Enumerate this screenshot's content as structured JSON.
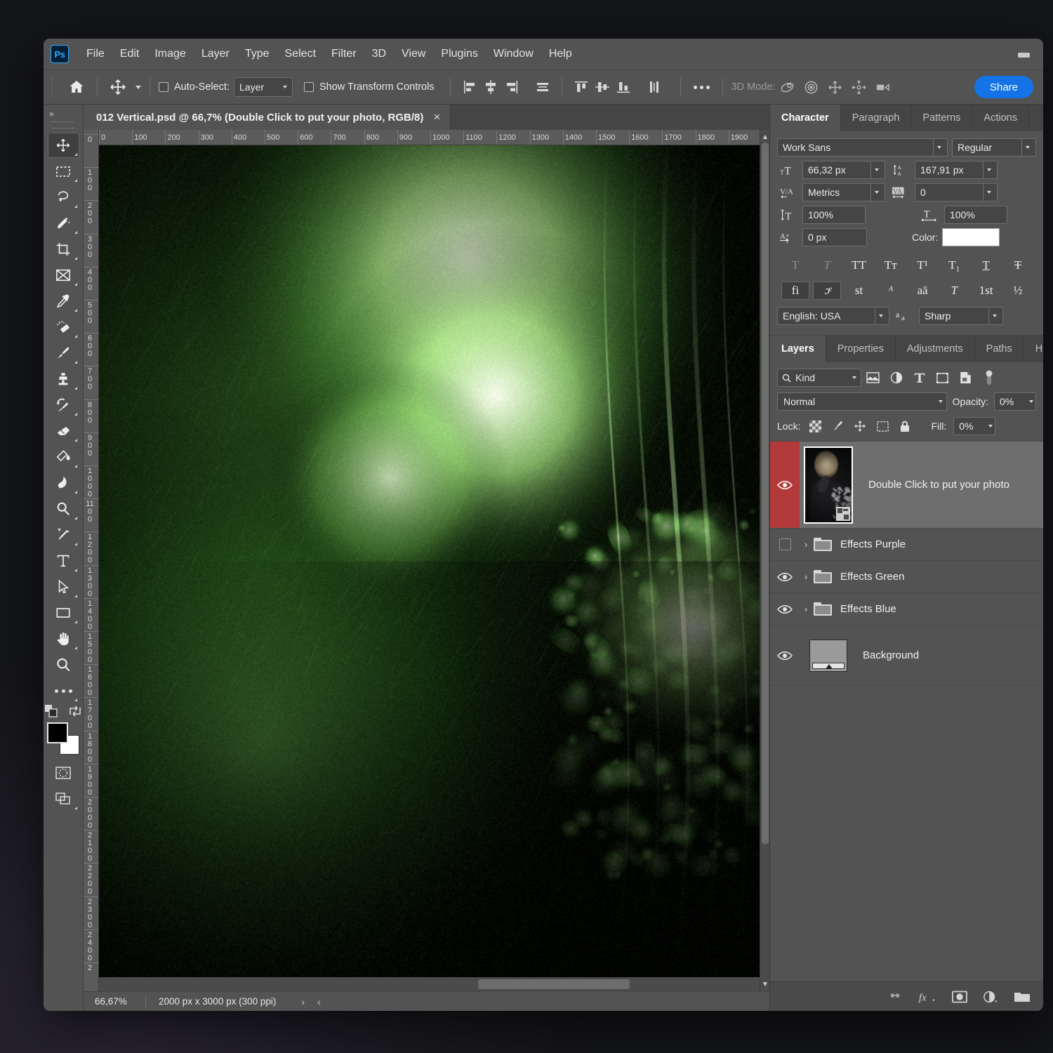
{
  "app": {
    "logo": "Ps",
    "menu": [
      "File",
      "Edit",
      "Image",
      "Layer",
      "Type",
      "Select",
      "Filter",
      "3D",
      "View",
      "Plugins",
      "Window",
      "Help"
    ],
    "minimize_icon": "minimize-icon"
  },
  "options_bar": {
    "home_icon": "home-icon",
    "tool_icon": "move-tool-icon",
    "auto_select_label": "Auto-Select:",
    "auto_select_value": "Layer",
    "show_transform_label": "Show Transform Controls",
    "align_icons": [
      "align-left-edges-icon",
      "align-horizontal-centers-icon",
      "align-right-edges-icon",
      "distribute-horizontal-icon",
      "align-top-edges-icon",
      "align-vertical-centers-icon",
      "align-bottom-edges-icon",
      "distribute-vertical-icon"
    ],
    "more_icon": "more-options-icon",
    "mode_3d_label": "3D Mode:",
    "mode_3d_icons": [
      "rotate-3d-icon",
      "roll-3d-icon",
      "pan-3d-icon",
      "slide-3d-icon",
      "scale-3d-camera-icon"
    ],
    "share_label": "Share"
  },
  "toolbar": {
    "collapse_icon": "»",
    "tools": [
      {
        "name": "move-tool",
        "active": true
      },
      {
        "name": "rectangular-marquee-tool",
        "active": false
      },
      {
        "name": "lasso-tool",
        "active": false
      },
      {
        "name": "object-selection-tool",
        "active": false
      },
      {
        "name": "crop-tool",
        "active": false
      },
      {
        "name": "frame-tool",
        "active": false
      },
      {
        "name": "eyedropper-tool",
        "active": false
      },
      {
        "name": "spot-healing-brush-tool",
        "active": false
      },
      {
        "name": "brush-tool",
        "active": false
      },
      {
        "name": "clone-stamp-tool",
        "active": false
      },
      {
        "name": "history-brush-tool",
        "active": false
      },
      {
        "name": "eraser-tool",
        "active": false
      },
      {
        "name": "gradient-tool",
        "active": false
      },
      {
        "name": "blur-tool",
        "active": false
      },
      {
        "name": "dodge-tool",
        "active": false
      },
      {
        "name": "pen-tool",
        "active": false
      },
      {
        "name": "type-tool",
        "active": false
      },
      {
        "name": "path-selection-tool",
        "active": false
      },
      {
        "name": "rectangle-tool",
        "active": false
      },
      {
        "name": "hand-tool",
        "active": false
      },
      {
        "name": "zoom-tool",
        "active": false
      },
      {
        "name": "edit-toolbar-tool",
        "active": false
      }
    ],
    "foreground_color": "#000000",
    "background_color": "#ffffff",
    "quickmask_icon": "quick-mask-icon",
    "screenmode_icon": "screen-mode-icon"
  },
  "document": {
    "tab_title": "012 Vertical.psd @ 66,7% (Double Click to put your photo, RGB/8)",
    "close_icon": "×",
    "h_ruler_ticks": [
      "0",
      "100",
      "200",
      "300",
      "400",
      "500",
      "600",
      "700",
      "800",
      "900",
      "1000",
      "1100",
      "1200",
      "1300",
      "1400",
      "1500",
      "1600",
      "1700",
      "1800",
      "1900"
    ],
    "v_ruler_ticks": [
      "0",
      "100",
      "200",
      "300",
      "400",
      "500",
      "600",
      "700",
      "800",
      "900",
      "1000",
      "1100",
      "1200",
      "1300",
      "1400",
      "1500",
      "1600",
      "1700",
      "1800",
      "1900",
      "2000",
      "2100",
      "2200",
      "2300",
      "2400",
      "2"
    ]
  },
  "status_bar": {
    "zoom": "66,67%",
    "dimensions": "2000 px x 3000 px (300 ppi)",
    "next_chevron": "›",
    "prev_chevron": "‹"
  },
  "character_panel": {
    "tabs": [
      {
        "label": "Character",
        "active": true
      },
      {
        "label": "Paragraph",
        "active": false
      },
      {
        "label": "Patterns",
        "active": false
      },
      {
        "label": "Actions",
        "active": false
      }
    ],
    "font_family": "Work Sans",
    "font_style": "Regular",
    "font_size_icon": "font-size-icon",
    "font_size": "66,32 px",
    "leading_icon": "leading-icon",
    "leading": "167,91 px",
    "kerning_icon": "kerning-icon",
    "kerning": "Metrics",
    "tracking_icon": "tracking-icon",
    "tracking": "0",
    "vertical_scale_icon": "vertical-scale-icon",
    "vertical_scale": "100%",
    "horizontal_scale_icon": "horizontal-scale-icon",
    "horizontal_scale": "100%",
    "baseline_icon": "baseline-shift-icon",
    "baseline_shift": "0 px",
    "color_label": "Color:",
    "color_value": "#ffffff",
    "style_buttons_row1": [
      "T",
      "T",
      "TT",
      "Tт",
      "T¹",
      "T₁",
      "T",
      "T"
    ],
    "style_names_row1": [
      "faux-bold-icon",
      "faux-italic-icon",
      "all-caps-icon",
      "small-caps-icon",
      "superscript-icon",
      "subscript-icon",
      "underline-icon",
      "strikethrough-icon"
    ],
    "style_buttons_row2": [
      "fi",
      "ɔͤ",
      "st",
      "ᴬ",
      "aā",
      "T",
      "1st",
      "½"
    ],
    "style_names_row2": [
      "standard-ligatures-icon",
      "contextual-alternates-icon",
      "discretionary-ligatures-icon",
      "swash-icon",
      "titling-alternates-icon",
      "stylistic-alternates-icon",
      "ordinals-icon",
      "fractions-icon"
    ],
    "language": "English: USA",
    "aa_icon": "anti-alias-icon",
    "anti_alias": "Sharp"
  },
  "layers_panel": {
    "tabs": [
      {
        "label": "Layers",
        "active": true
      },
      {
        "label": "Properties",
        "active": false
      },
      {
        "label": "Adjustments",
        "active": false
      },
      {
        "label": "Paths",
        "active": false
      },
      {
        "label": "History",
        "active": false
      }
    ],
    "filter_icon": "search-icon",
    "filter_kind": "Kind",
    "filter_type_icons": [
      "pixel-layer-filter-icon",
      "adjustment-layer-filter-icon",
      "type-layer-filter-icon",
      "shape-layer-filter-icon",
      "smart-object-filter-icon"
    ],
    "filter_toggle_icon": "filter-toggle-icon",
    "blend_mode": "Normal",
    "opacity_label": "Opacity:",
    "opacity_value": "0%",
    "lock_label": "Lock:",
    "lock_icons": [
      "lock-transparent-pixels-icon",
      "lock-image-pixels-icon",
      "lock-position-icon",
      "lock-artboard-nesting-icon",
      "lock-all-icon"
    ],
    "fill_label": "Fill:",
    "fill_value": "0%",
    "layers": [
      {
        "name": "Double Click to put your photo",
        "visible": true,
        "selected": true,
        "type": "smart-object",
        "expandable": false
      },
      {
        "name": "Effects  Purple",
        "visible": false,
        "selected": false,
        "type": "group",
        "expandable": true
      },
      {
        "name": "Effects Green",
        "visible": true,
        "selected": false,
        "type": "group",
        "expandable": true
      },
      {
        "name": "Effects Blue",
        "visible": true,
        "selected": false,
        "type": "group",
        "expandable": true
      },
      {
        "name": "Background",
        "visible": true,
        "selected": false,
        "type": "background",
        "expandable": false
      }
    ],
    "bottom_icons": [
      "link-layers-icon",
      "add-layer-style-icon",
      "add-layer-mask-icon",
      "new-adjustment-layer-icon",
      "new-group-icon"
    ],
    "selected_highlight_color": "#b33a3a"
  },
  "artwork": {
    "description": "green toned portrait of a person with glowing light effects",
    "accent_color": "#8ddb72",
    "dark_color": "#0a1206"
  }
}
